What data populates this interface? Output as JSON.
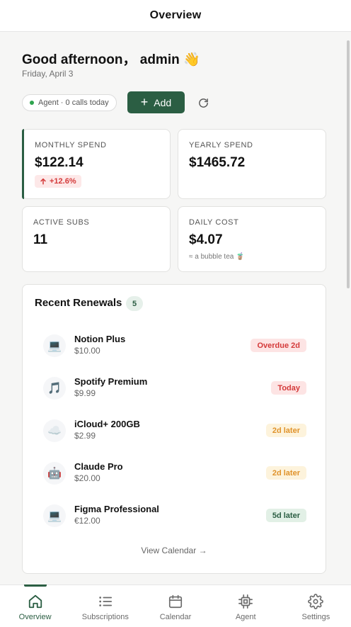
{
  "header": {
    "title": "Overview"
  },
  "greeting": {
    "text": "Good afternoon， admin 👋",
    "date": "Friday, April 3"
  },
  "agent": {
    "status": "Agent · 0 calls today"
  },
  "actions": {
    "add_label": "Add",
    "add_icon": "plus-icon",
    "refresh_icon": "refresh-icon"
  },
  "stats": {
    "monthly": {
      "label": "MONTHLY SPEND",
      "value": "$122.14",
      "trend": "+12.6%",
      "trend_icon": "arrow-up-icon"
    },
    "yearly": {
      "label": "YEARLY SPEND",
      "value": "$1465.72"
    },
    "active": {
      "label": "ACTIVE SUBS",
      "value": "11"
    },
    "daily": {
      "label": "DAILY COST",
      "value": "$4.07",
      "note": "≈ a bubble tea 🧋"
    }
  },
  "renewals": {
    "title": "Recent Renewals",
    "count": "5",
    "items": [
      {
        "icon": "💻",
        "icon_name": "laptop-icon",
        "name": "Notion Plus",
        "price": "$10.00",
        "badge": "Overdue 2d",
        "status": "overdue"
      },
      {
        "icon": "🎵",
        "icon_name": "music-note-icon",
        "name": "Spotify Premium",
        "price": "$9.99",
        "badge": "Today",
        "status": "today"
      },
      {
        "icon": "☁️",
        "icon_name": "cloud-icon",
        "name": "iCloud+ 200GB",
        "price": "$2.99",
        "badge": "2d later",
        "status": "soon"
      },
      {
        "icon": "🤖",
        "icon_name": "robot-icon",
        "name": "Claude Pro",
        "price": "$20.00",
        "badge": "2d later",
        "status": "soon"
      },
      {
        "icon": "💻",
        "icon_name": "laptop-icon",
        "name": "Figma Professional",
        "price": "€12.00",
        "badge": "5d later",
        "status": "later"
      }
    ],
    "view_calendar": "View Calendar →"
  },
  "nav": {
    "items": [
      {
        "label": "Overview",
        "icon": "home-icon",
        "active": true
      },
      {
        "label": "Subscriptions",
        "icon": "list-icon",
        "active": false
      },
      {
        "label": "Calendar",
        "icon": "calendar-icon",
        "active": false
      },
      {
        "label": "Agent",
        "icon": "chip-icon",
        "active": false
      },
      {
        "label": "Settings",
        "icon": "gear-icon",
        "active": false
      }
    ]
  },
  "colors": {
    "accent": "#2b5e43",
    "overdue": "#d43a3a",
    "soon": "#e0922a",
    "background": "#f6f6f5"
  }
}
